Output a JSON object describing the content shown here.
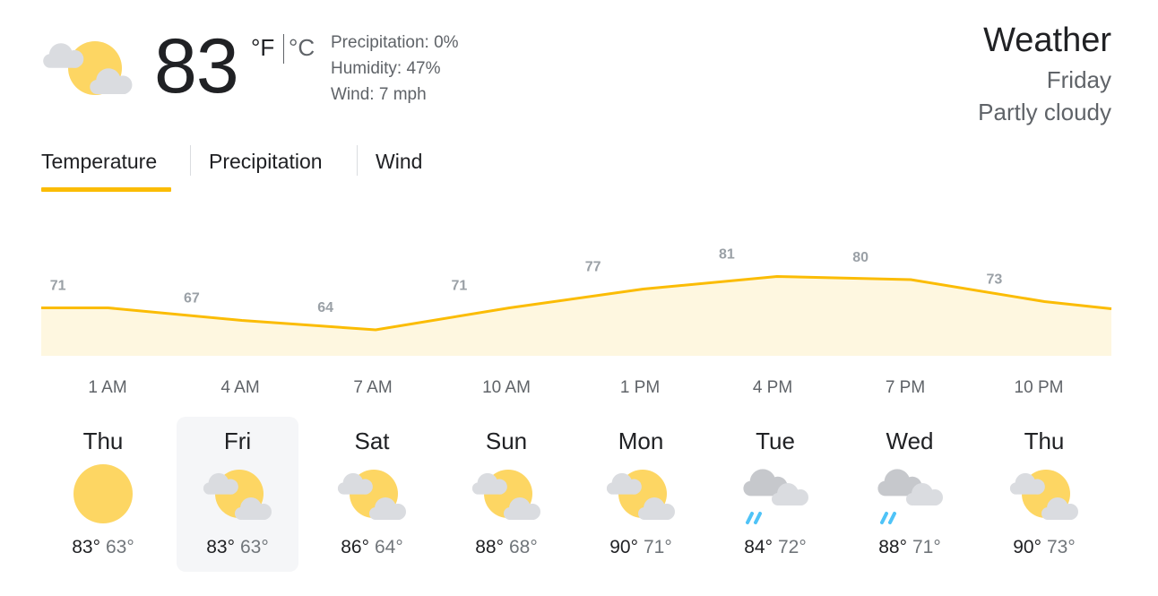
{
  "current": {
    "icon": "partly-cloudy-icon",
    "temperature": "83",
    "unit_f": "°F",
    "unit_c": "°C",
    "precipitation": "Precipitation: 0%",
    "humidity": "Humidity: 47%",
    "wind": "Wind: 7 mph"
  },
  "header": {
    "title": "Weather",
    "day": "Friday",
    "condition": "Partly cloudy"
  },
  "tabs": [
    {
      "label": "Temperature",
      "active": true
    },
    {
      "label": "Precipitation",
      "active": false
    },
    {
      "label": "Wind",
      "active": false
    }
  ],
  "colors": {
    "accent": "#fbbc04",
    "chart_fill": "#fef7e0",
    "chart_label": "#9aa0a6",
    "sun": "#fdd663",
    "cloud": "#dadce0",
    "rain": "#4fc3f7"
  },
  "chart_data": {
    "type": "area",
    "x": [
      "1 AM",
      "4 AM",
      "7 AM",
      "10 AM",
      "1 PM",
      "4 PM",
      "7 PM",
      "10 PM"
    ],
    "values": [
      71,
      67,
      64,
      71,
      77,
      81,
      80,
      73
    ],
    "title": "",
    "xlabel": "",
    "ylabel": "",
    "grid": false
  },
  "hourly_labels": [
    "1 AM",
    "4 AM",
    "7 AM",
    "10 AM",
    "1 PM",
    "4 PM",
    "7 PM",
    "10 PM"
  ],
  "forecast": [
    {
      "day": "Thu",
      "icon": "sunny-icon",
      "high": "83°",
      "low": "63°",
      "selected": false
    },
    {
      "day": "Fri",
      "icon": "partly-cloudy-icon",
      "high": "83°",
      "low": "63°",
      "selected": true
    },
    {
      "day": "Sat",
      "icon": "partly-cloudy-icon",
      "high": "86°",
      "low": "64°",
      "selected": false
    },
    {
      "day": "Sun",
      "icon": "partly-cloudy-icon",
      "high": "88°",
      "low": "68°",
      "selected": false
    },
    {
      "day": "Mon",
      "icon": "partly-cloudy-icon",
      "high": "90°",
      "low": "71°",
      "selected": false
    },
    {
      "day": "Tue",
      "icon": "rain-icon",
      "high": "84°",
      "low": "72°",
      "selected": false
    },
    {
      "day": "Wed",
      "icon": "rain-icon",
      "high": "88°",
      "low": "71°",
      "selected": false
    },
    {
      "day": "Thu",
      "icon": "partly-cloudy-icon",
      "high": "90°",
      "low": "73°",
      "selected": false
    }
  ]
}
